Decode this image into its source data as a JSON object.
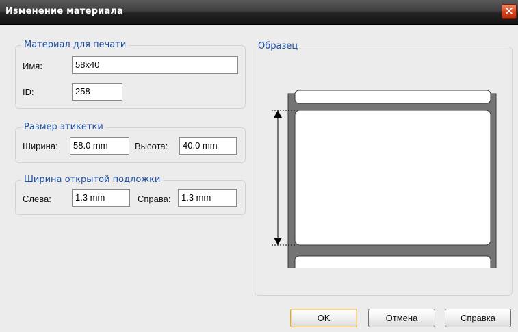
{
  "window": {
    "title": "Изменение материала"
  },
  "material_group": {
    "title": "Материал для печати",
    "name_label": "Имя:",
    "name_value": "58x40",
    "id_label": "ID:",
    "id_value": "258"
  },
  "size_group": {
    "title": "Размер этикетки",
    "width_label": "Ширина:",
    "width_value": "58.0 mm",
    "height_label": "Высота:",
    "height_value": "40.0 mm"
  },
  "liner_group": {
    "title": "Ширина открытой подложки",
    "left_label": "Слева:",
    "left_value": "1.3 mm",
    "right_label": "Справа:",
    "right_value": "1.3 mm"
  },
  "sample_group": {
    "title": "Образец"
  },
  "buttons": {
    "ok": "OK",
    "cancel": "Отмена",
    "help": "Справка"
  }
}
